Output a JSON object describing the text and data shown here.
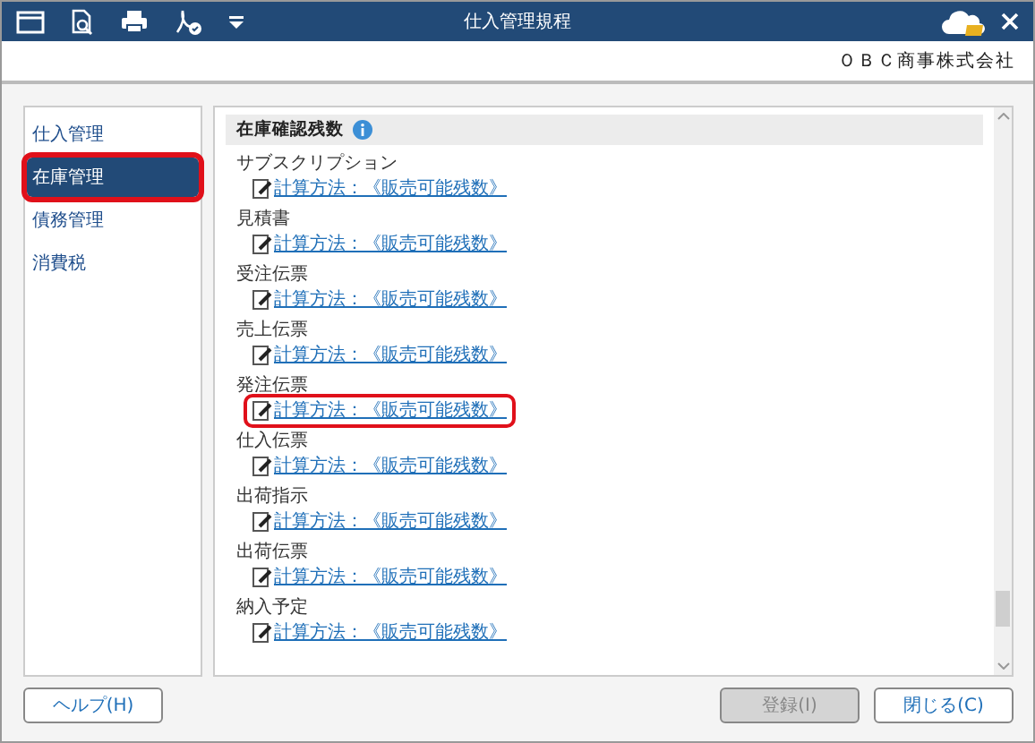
{
  "window": {
    "title": "仕入管理規程"
  },
  "company": "ＯＢＣ商事株式会社",
  "sidebar": {
    "items": [
      {
        "label": "仕入管理",
        "selected": false,
        "highlighted": false
      },
      {
        "label": "在庫管理",
        "selected": true,
        "highlighted": true
      },
      {
        "label": "債務管理",
        "selected": false,
        "highlighted": false
      },
      {
        "label": "消費税",
        "selected": false,
        "highlighted": false
      }
    ]
  },
  "section": {
    "title": "在庫確認残数"
  },
  "items": [
    {
      "label": "サブスクリプション",
      "link": "計算方法：《販売可能残数》",
      "highlighted": false
    },
    {
      "label": "見積書",
      "link": "計算方法：《販売可能残数》",
      "highlighted": false
    },
    {
      "label": "受注伝票",
      "link": "計算方法：《販売可能残数》",
      "highlighted": false
    },
    {
      "label": "売上伝票",
      "link": "計算方法：《販売可能残数》",
      "highlighted": false
    },
    {
      "label": "発注伝票",
      "link": "計算方法：《販売可能残数》",
      "highlighted": true
    },
    {
      "label": "仕入伝票",
      "link": "計算方法：《販売可能残数》",
      "highlighted": false
    },
    {
      "label": "出荷指示",
      "link": "計算方法：《販売可能残数》",
      "highlighted": false
    },
    {
      "label": "出荷伝票",
      "link": "計算方法：《販売可能残数》",
      "highlighted": false
    },
    {
      "label": "納入予定",
      "link": "計算方法：《販売可能残数》",
      "highlighted": false
    }
  ],
  "buttons": [
    {
      "label": "ヘルプ(H)",
      "disabled": false
    },
    {
      "label": "登録(I)",
      "disabled": true
    },
    {
      "label": "閉じる(C)",
      "disabled": false
    }
  ]
}
